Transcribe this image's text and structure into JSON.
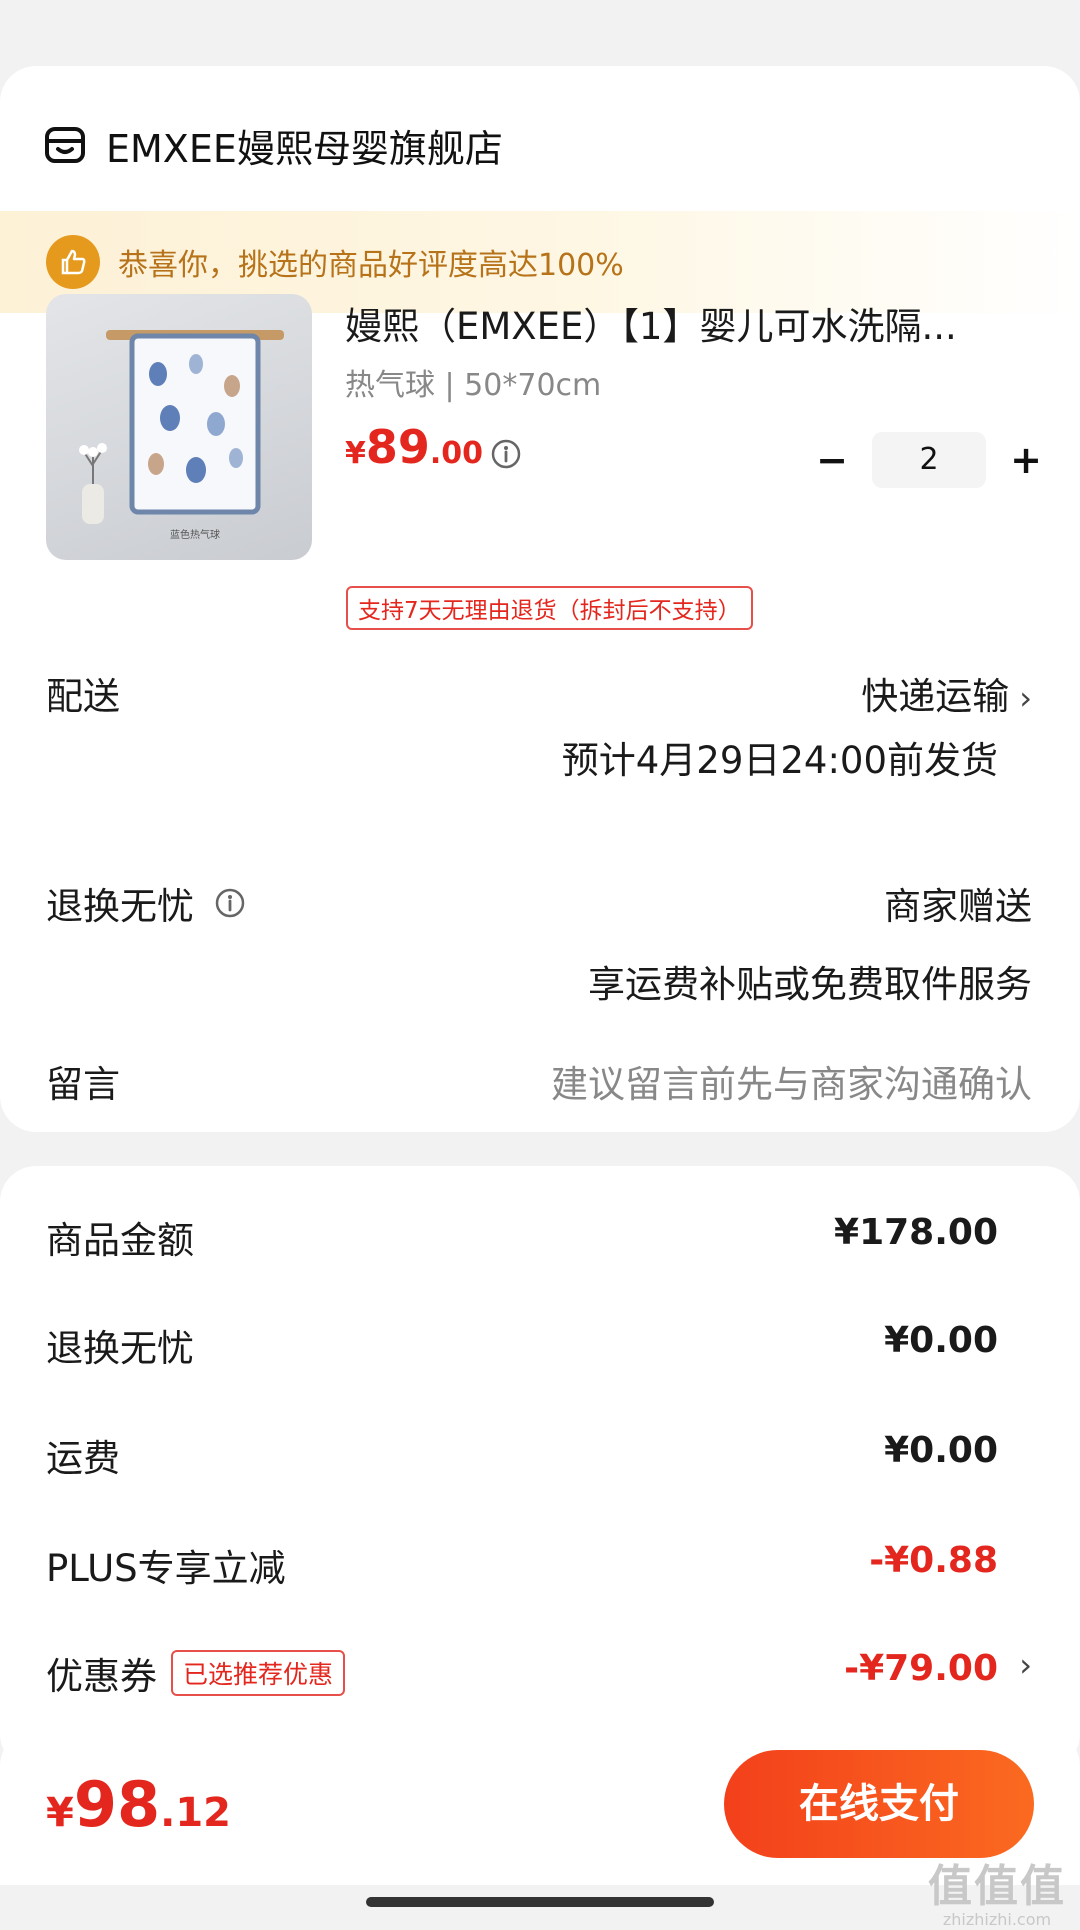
{
  "store": {
    "name": "EMXEE嫚熙母婴旗舰店",
    "icon": "shop-icon"
  },
  "congrats": {
    "text": "恭喜你，挑选的商品好评度高达100%",
    "icon": "thumbs-up-icon"
  },
  "product": {
    "title": "嫚熙（EMXEE）【1】婴儿可水洗隔...",
    "spec": "热气球 | 50*70cm",
    "image_caption": "蓝色热气球",
    "price_currency": "¥",
    "price_int": "89",
    "price_dec": ".00",
    "quantity": "2",
    "return_badge": "支持7天无理由退货（拆封后不支持）"
  },
  "delivery": {
    "label": "配送",
    "method": "快递运输",
    "estimate": "预计4月29日24:00前发货"
  },
  "return_service": {
    "label": "退换无忧",
    "value": "商家赠送",
    "desc": "享运费补贴或免费取件服务"
  },
  "message": {
    "label": "留言",
    "placeholder": "建议留言前先与商家沟通确认"
  },
  "summary": {
    "goods_label": "商品金额",
    "goods_value": "¥178.00",
    "return_label": "退换无忧",
    "return_value": "¥0.00",
    "shipping_label": "运费",
    "shipping_value": "¥0.00",
    "plus_label": "PLUS专享立减",
    "plus_value": "-¥0.88",
    "coupon_label": "优惠券",
    "coupon_badge": "已选推荐优惠",
    "coupon_value": "-¥79.00"
  },
  "footer": {
    "total_currency": "¥",
    "total_int": "98",
    "total_dec": ".12",
    "pay_label": "在线支付"
  },
  "watermark": {
    "main": "值值值",
    "sub": "zhizhizhi.com"
  },
  "colors": {
    "accent_red": "#e4271e",
    "pay_gradient_start": "#f3401b",
    "pay_gradient_end": "#fb6a20",
    "congrats_text": "#b7731a",
    "thumb_icon": "#e59a1e"
  }
}
